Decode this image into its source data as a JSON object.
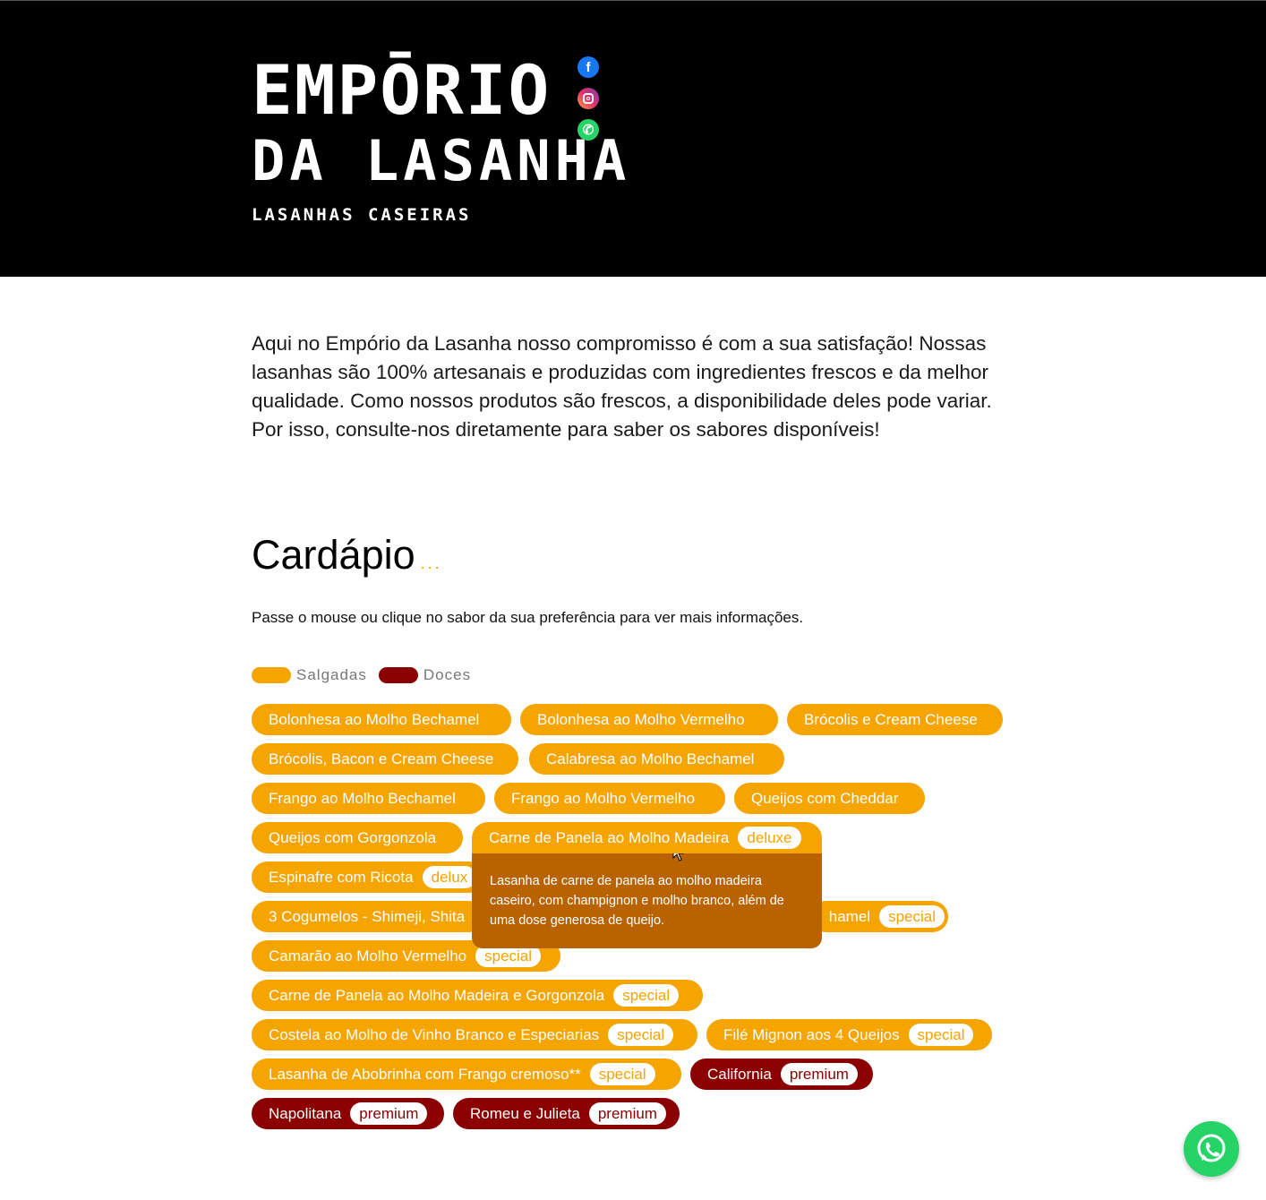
{
  "header": {
    "logo": {
      "line1": "EMPŌRIO",
      "line2": "DA LASANHA",
      "tagline": "LASANHAS CASEIRAS"
    },
    "social": [
      {
        "name": "facebook-icon",
        "glyph": "f"
      },
      {
        "name": "instagram-icon",
        "glyph": ""
      },
      {
        "name": "whatsapp-icon",
        "glyph": "✆"
      }
    ]
  },
  "intro": "Aqui no Empório da Lasanha nosso compromisso é com a sua satisfação! Nossas lasanhas são 100% artesanais e produzidas com ingredientes frescos e da melhor qualidade. Como nossos produtos são frescos, a disponibilidade deles pode variar. Por isso, consulte-nos diretamente para saber os sabores disponíveis!",
  "menu": {
    "title": "Cardápio",
    "title_dots": "...",
    "hint": "Passe o mouse ou clique no sabor da sua preferência para ver mais informações.",
    "legend": [
      {
        "label": "Salgadas",
        "color": "#f5a400"
      },
      {
        "label": "Doces",
        "color": "#8b0000"
      }
    ],
    "flavors": [
      {
        "label": "Bolonhesa ao Molho Bechamel",
        "type": "salgada",
        "badge": ""
      },
      {
        "label": "Bolonhesa ao Molho Vermelho",
        "type": "salgada",
        "badge": ""
      },
      {
        "label": "Brócolis e Cream Cheese",
        "type": "salgada",
        "badge": ""
      },
      {
        "label": "Brócolis, Bacon e Cream Cheese",
        "type": "salgada",
        "badge": ""
      },
      {
        "label": "Calabresa ao Molho Bechamel",
        "type": "salgada",
        "badge": ""
      },
      {
        "label": "Frango ao Molho Bechamel",
        "type": "salgada",
        "badge": ""
      },
      {
        "label": "Frango ao Molho Vermelho",
        "type": "salgada",
        "badge": ""
      },
      {
        "label": "Queijos com Cheddar",
        "type": "salgada",
        "badge": ""
      },
      {
        "label": "Queijos com Gorgonzola",
        "type": "salgada",
        "badge": ""
      },
      {
        "label": "Carne de Panela ao Molho Madeira",
        "type": "salgada",
        "badge": "deluxe"
      },
      {
        "label": "Espinafre com Ricota",
        "type": "salgada",
        "badge": "delux"
      },
      {
        "label": "3 Cogumelos - Shimeji, Shita",
        "type": "salgada",
        "badge": ""
      },
      {
        "label": "hamel",
        "type": "salgada",
        "badge": "special"
      },
      {
        "label": "Camarão ao Molho Vermelho",
        "type": "salgada",
        "badge": "special"
      },
      {
        "label": "Carne de Panela ao Molho Madeira e Gorgonzola",
        "type": "salgada",
        "badge": "special"
      },
      {
        "label": "Costela ao Molho de Vinho Branco e Especiarias",
        "type": "salgada",
        "badge": "special"
      },
      {
        "label": "Filé Mignon aos 4 Queijos",
        "type": "salgada",
        "badge": "special"
      },
      {
        "label": "Lasanha de Abobrinha com Frango cremoso**",
        "type": "salgada",
        "badge": "special"
      },
      {
        "label": "California",
        "type": "doce",
        "badge": "premium"
      },
      {
        "label": "Napolitana",
        "type": "doce",
        "badge": "premium"
      },
      {
        "label": "Romeu e Julieta",
        "type": "doce",
        "badge": "premium"
      }
    ],
    "tooltip": "Lasanha de carne de panela ao molho madeira caseiro, com champignon e molho branco, além de uma dose generosa de queijo."
  },
  "floating_whatsapp": {
    "icon": "whatsapp-icon",
    "glyph": "✆"
  }
}
